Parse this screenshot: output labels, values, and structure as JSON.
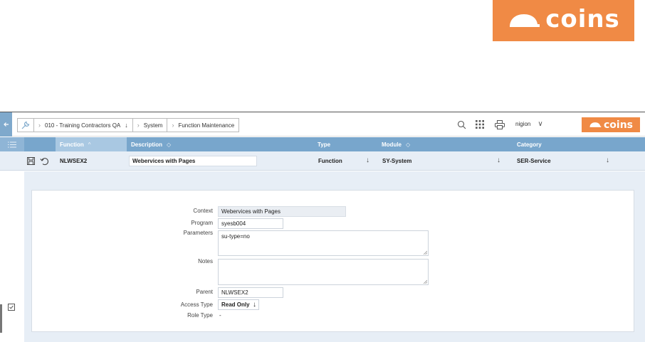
{
  "brand": {
    "logo_text": "coins",
    "accent": "#f08a45",
    "header_blue": "#78a6cc",
    "row_bg": "#e7eef6"
  },
  "topbar": {
    "icons": [
      "back-arrow-icon",
      "wrench-icon",
      "search-icon",
      "grid-icon",
      "print-icon"
    ],
    "breadcrumbs": [
      "010 - Training Contractors QA",
      "System",
      "Function Maintenance"
    ],
    "user": "nigion"
  },
  "grid": {
    "columns": [
      {
        "label": "Function",
        "sort": "^"
      },
      {
        "label": "Description",
        "sort": "◇"
      },
      {
        "label": "Type",
        "sort": ""
      },
      {
        "label": "Module",
        "sort": "◇"
      },
      {
        "label": "Category",
        "sort": ""
      }
    ],
    "row": {
      "function": "NLWSEX2",
      "description": "Webervices with Pages",
      "type": "Function",
      "module": "SY-System",
      "category": "SER-Service"
    }
  },
  "detail": {
    "context_label": "Context",
    "context_value": "Webervices with Pages",
    "program_label": "Program",
    "program_value": "syesb004",
    "parameters_label": "Parameters",
    "parameters_value": "su-type=no",
    "notes_label": "Notes",
    "notes_value": "",
    "parent_label": "Parent",
    "parent_value": "NLWSEX2",
    "access_type_label": "Access Type",
    "access_type_value": "Read Only",
    "role_type_label": "Role Type",
    "role_type_value": "-"
  }
}
